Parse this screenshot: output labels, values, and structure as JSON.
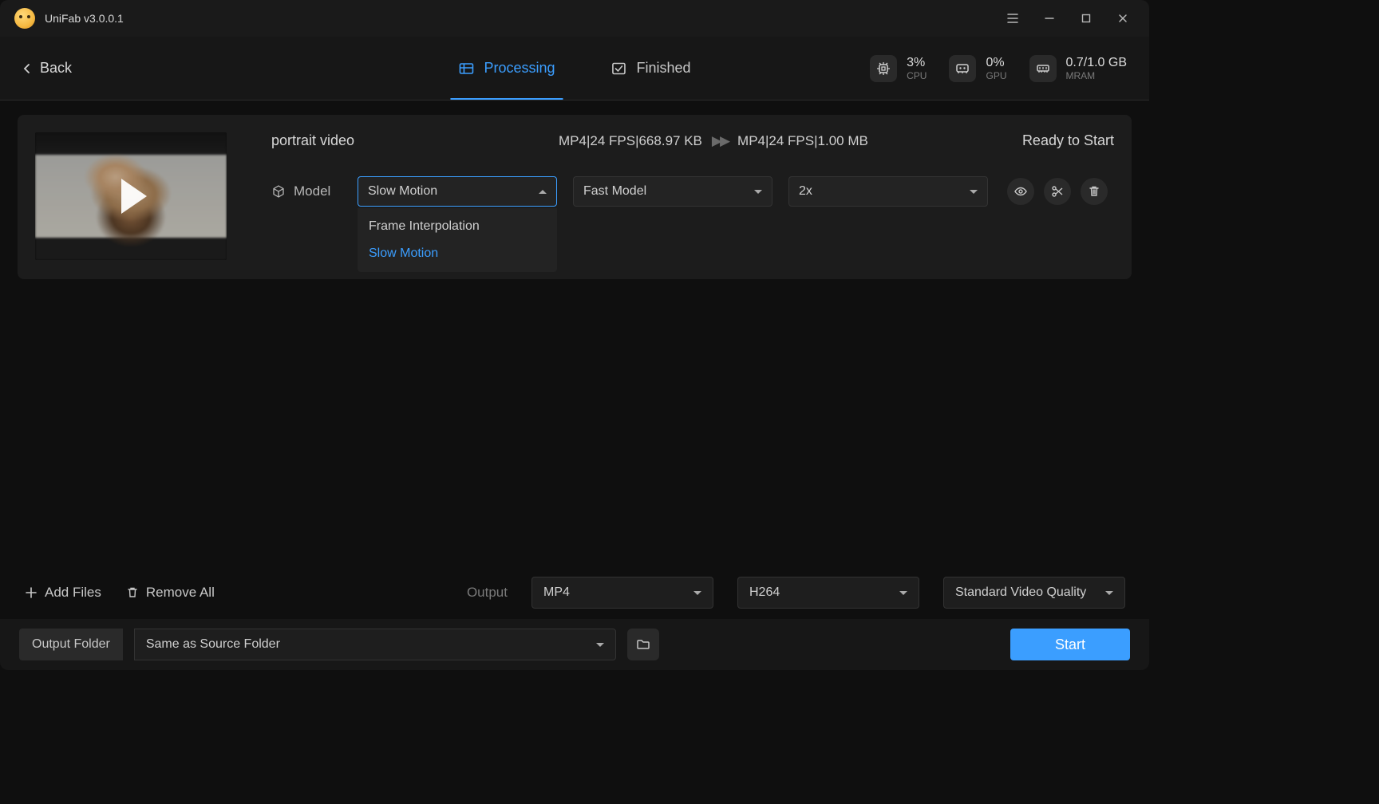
{
  "app": {
    "title": "UniFab v3.0.0.1"
  },
  "topbar": {
    "back": "Back",
    "tabs": {
      "processing": "Processing",
      "finished": "Finished"
    },
    "stats": {
      "cpu": {
        "value": "3%",
        "label": "CPU"
      },
      "gpu": {
        "value": "0%",
        "label": "GPU"
      },
      "mram": {
        "value": "0.7/1.0 GB",
        "label": "MRAM"
      }
    }
  },
  "card": {
    "title": "portrait video",
    "spec_in": "MP4|24 FPS|668.97 KB",
    "spec_out": "MP4|24 FPS|1.00 MB",
    "status": "Ready to Start",
    "model_label": "Model",
    "select_model": {
      "value": "Slow Motion",
      "options": [
        "Frame Interpolation",
        "Slow Motion"
      ]
    },
    "select_speed_model": {
      "value": "Fast Model"
    },
    "select_multiplier": {
      "value": "2x"
    }
  },
  "bottom": {
    "add_files": "Add Files",
    "remove_all": "Remove All",
    "output_label": "Output",
    "format": "MP4",
    "codec": "H264",
    "quality": "Standard Video Quality"
  },
  "footer": {
    "output_folder_label": "Output Folder",
    "output_folder_value": "Same as Source Folder",
    "start": "Start"
  }
}
